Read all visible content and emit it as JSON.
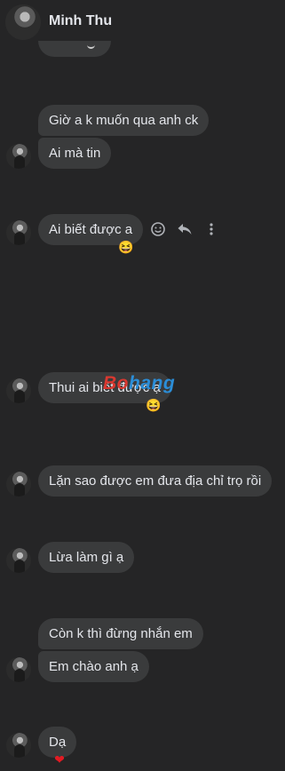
{
  "header": {
    "name": "Minh Thu"
  },
  "messages": [
    {
      "text": "Giờ a k muốn qua anh ck"
    },
    {
      "text": "Ai mà tin"
    },
    {
      "text": "Ai biết được a"
    },
    {
      "text": "Thui ai biết được ạ"
    },
    {
      "text": "Lặn sao được em đưa địa chỉ trọ rồi"
    },
    {
      "text": "Lừa làm gì ạ"
    },
    {
      "text": "Còn k thì đừng nhắn em"
    },
    {
      "text": "Em chào anh ạ"
    },
    {
      "text": "Dạ"
    }
  ],
  "reactions": {
    "laugh": "😆",
    "heart": "❤"
  },
  "watermark": {
    "part1": "Bo",
    "part2": "hang"
  },
  "icons": [
    "emoji-icon",
    "reply-icon",
    "more-icon"
  ],
  "colors": {
    "background": "#252526",
    "bubble": "#3a3b3c",
    "text": "#e4e6eb"
  }
}
